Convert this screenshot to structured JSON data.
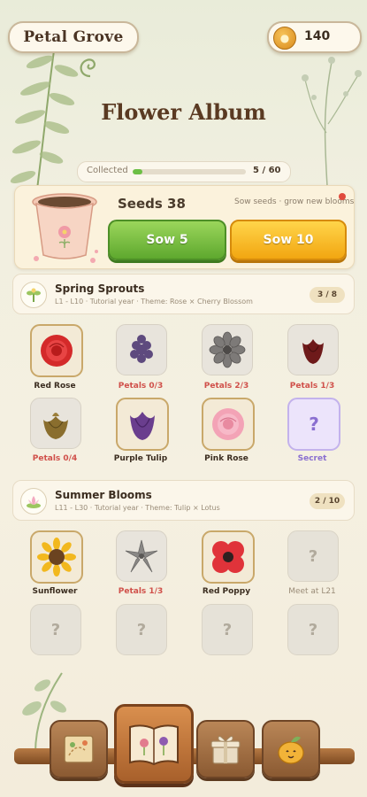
{
  "header": {
    "app_title": "Petal Grove",
    "coins": "140",
    "coin_icon": "coin-icon"
  },
  "album": {
    "title": "Flower Album"
  },
  "collected": {
    "label": "Collected",
    "count": "5 / 60",
    "progress": 0.083
  },
  "seeds": {
    "label": "Seeds 38",
    "tip": "Sow seeds · grow new blooms",
    "sow5": "Sow 5",
    "sow10": "Sow 10"
  },
  "sections": [
    {
      "name": "Spring Sprouts",
      "meta": "L1 - L10  ·  Tutorial year  ·  Theme: Rose × Cherry Blossom",
      "count": "3 / 8",
      "items": [
        {
          "label": "Red Rose",
          "icon": "red-rose-icon"
        },
        {
          "label": "Petals 0/3",
          "icon": "lilac-icon"
        },
        {
          "label": "Petals 2/3",
          "icon": "grey-dahlia-icon"
        },
        {
          "label": "Petals 1/3",
          "icon": "dark-tulip-icon"
        },
        {
          "label": "Petals 0/4",
          "icon": "olive-rose-icon"
        },
        {
          "label": "Purple Tulip",
          "icon": "purple-tulip-icon"
        },
        {
          "label": "Pink Rose",
          "icon": "pink-rose-icon"
        },
        {
          "label": "Secret",
          "icon": "question-icon",
          "glyph": "?"
        }
      ]
    },
    {
      "name": "Summer Blooms",
      "meta": "L11 - L30  ·  Tutorial year  ·  Theme: Tulip × Lotus",
      "count": "2 / 10",
      "items": [
        {
          "label": "Sunflower",
          "icon": "sunflower-icon"
        },
        {
          "label": "Petals 1/3",
          "icon": "grey-lily-icon"
        },
        {
          "label": "Red Poppy",
          "icon": "red-poppy-icon"
        },
        {
          "label": "Meet at L21",
          "icon": "question-icon",
          "glyph": "?"
        },
        {
          "label": "",
          "icon": "question-icon",
          "glyph": "?"
        },
        {
          "label": "",
          "icon": "question-icon",
          "glyph": "?"
        },
        {
          "label": "",
          "icon": "question-icon",
          "glyph": "?"
        },
        {
          "label": "",
          "icon": "question-icon",
          "glyph": "?"
        }
      ]
    }
  ],
  "nav": [
    "map-icon",
    "album-book-icon",
    "gift-box-icon",
    "seed-buddy-icon"
  ]
}
